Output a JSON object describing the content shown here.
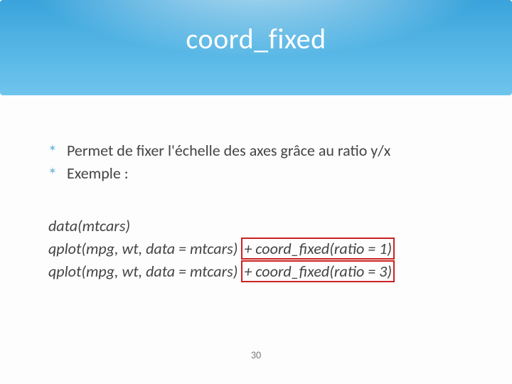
{
  "title": "coord_fixed",
  "bullets": [
    "Permet de fixer l'échelle des axes grâce au ratio y/x",
    "Exemple :"
  ],
  "code": {
    "line1": "data(mtcars)",
    "line2_pre": "qplot(mpg, wt, data = mtcars)",
    "line2_hl": "+ coord_fixed(ratio = 1)",
    "line3_pre": "qplot(mpg, wt, data = mtcars)",
    "line3_hl": "+ coord_fixed(ratio = 3)"
  },
  "page_number": "30"
}
